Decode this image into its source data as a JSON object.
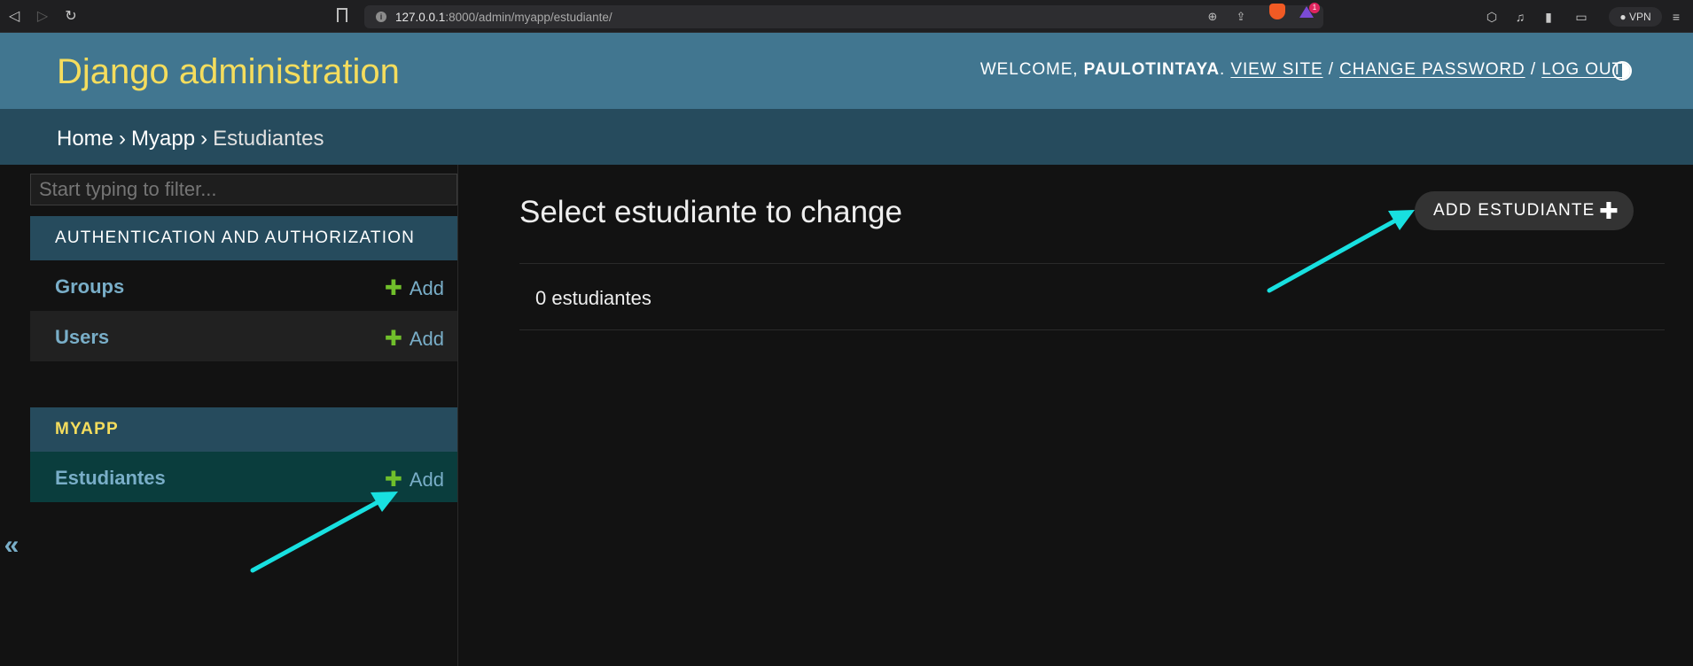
{
  "browser": {
    "url_host": "127.0.0.1",
    "url_path": ":8000/admin/myapp/estudiante/",
    "vpn_label": "VPN",
    "rewards_count": "1"
  },
  "header": {
    "branding": "Django administration",
    "welcome_prefix": "WELCOME, ",
    "username": "PAULOTINTAYA",
    "period": ".",
    "view_site": "VIEW SITE",
    "separator": "/",
    "change_password": "CHANGE PASSWORD",
    "log_out": "LOG OUT"
  },
  "breadcrumbs": {
    "home": "Home",
    "sep": "›",
    "app": "Myapp",
    "current": "Estudiantes"
  },
  "sidebar": {
    "filter_placeholder": "Start typing to filter...",
    "modules": [
      {
        "caption": "AUTHENTICATION AND AUTHORIZATION",
        "models": [
          {
            "name": "Groups",
            "add_label": "Add"
          },
          {
            "name": "Users",
            "add_label": "Add"
          }
        ]
      },
      {
        "caption": "MYAPP",
        "models": [
          {
            "name": "Estudiantes",
            "add_label": "Add"
          }
        ]
      }
    ],
    "plus_glyph": "✚",
    "collapse_glyph": "«"
  },
  "main": {
    "title": "Select estudiante to change",
    "add_button": "ADD ESTUDIANTE",
    "add_plus": "✚",
    "result_count": "0 estudiantes"
  },
  "colors": {
    "header_bg": "#417690",
    "branding": "#f5dd5d",
    "breadcrumbs_bg": "#264b5d",
    "link": "#79aec8",
    "add_plus": "#70bf2b",
    "selected_row": "#0a3d3d",
    "annotation_arrow": "#18e0e0"
  }
}
